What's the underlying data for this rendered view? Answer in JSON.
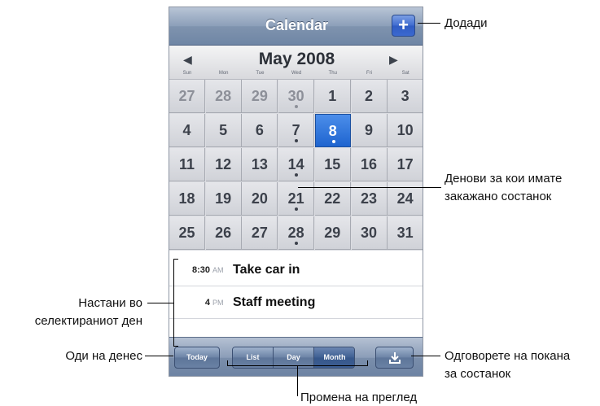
{
  "app": {
    "nav_title": "Calendar",
    "add_symbol": "+",
    "month_title": "May 2008",
    "prev_arrow": "◀",
    "next_arrow": "▶",
    "weekdays": [
      "Sun",
      "Mon",
      "Tue",
      "Wed",
      "Thu",
      "Fri",
      "Sat"
    ],
    "rows": [
      [
        "27",
        "28",
        "29",
        "30",
        "1",
        "2",
        "3"
      ],
      [
        "4",
        "5",
        "6",
        "7",
        "8",
        "9",
        "10"
      ],
      [
        "11",
        "12",
        "13",
        "14",
        "15",
        "16",
        "17"
      ],
      [
        "18",
        "19",
        "20",
        "21",
        "22",
        "23",
        "24"
      ],
      [
        "25",
        "26",
        "27",
        "28",
        "29",
        "30",
        "31"
      ]
    ],
    "prev_month_cells": [
      "0-0",
      "0-1",
      "0-2",
      "0-3"
    ],
    "dot_cells": [
      "0-3",
      "1-3",
      "1-4",
      "2-3",
      "3-3",
      "4-3"
    ],
    "selected_cell": "1-4",
    "events": [
      {
        "time": "8:30",
        "ampm": "AM",
        "title": "Take car in"
      },
      {
        "time": "4",
        "ampm": "PM",
        "title": "Staff meeting"
      }
    ],
    "toolbar": {
      "today": "Today",
      "segments": [
        "List",
        "Day",
        "Month"
      ],
      "active_segment": "Month",
      "inbox_icon": "download-icon"
    }
  },
  "callouts": {
    "add": "Додади",
    "days_line1": "Денови за кои имате",
    "days_line2": "закажано состанок",
    "selected_line1": "Настани во",
    "selected_line2": "селектираниот ден",
    "today": "Оди на денес",
    "invite_line1": "Одговорете на покана",
    "invite_line2": "за состанок",
    "change_view": "Промена на преглед"
  },
  "colors": {
    "selected": "#1e64cf",
    "navbar": "#7f93ae"
  }
}
